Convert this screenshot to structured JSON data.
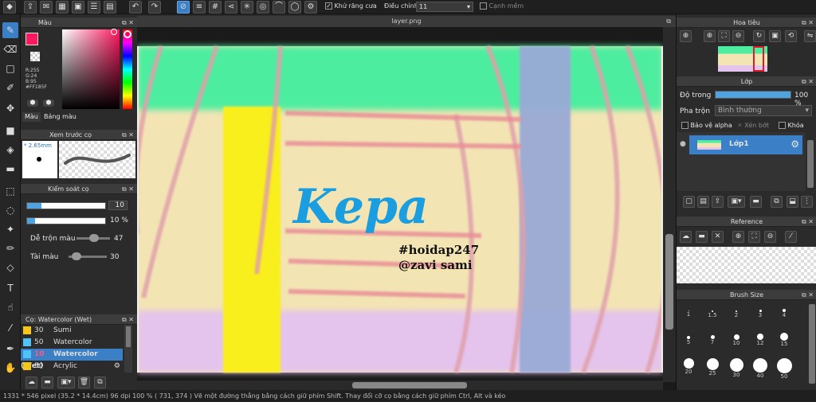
{
  "toolbar": {
    "antialias_label": "Khử răng cưa",
    "correction_label": "Điều chỉnh",
    "correction_value": "11",
    "snap_label": "Cạnh mềm",
    "antialias_checked": true,
    "snap_checked": false
  },
  "document": {
    "tab_title": "layer.png"
  },
  "color_panel": {
    "title": "Màu",
    "r": "R:255",
    "g": "G:24",
    "b": "B:95",
    "hex": "#FF185F",
    "tab_color": "Màu",
    "tab_palette": "Bảng màu",
    "accent": "#FF185F"
  },
  "preview_panel": {
    "title": "Xem trước cọ",
    "size": "2.65mm"
  },
  "brush_control": {
    "title": "Kiểm soát cọ",
    "size_value": "10",
    "opacity_value": "10 %",
    "blend_label": "Dễ trộn màu",
    "blend_value": "47",
    "amount_label": "Tài màu",
    "amount_value": "30"
  },
  "brush_list": {
    "title": "Cọ: Watercolor (Wet)",
    "items": [
      {
        "size": "30",
        "name": "Sumi",
        "color": "#f5c518"
      },
      {
        "size": "50",
        "name": "Watercolor",
        "color": "#4fc3f7"
      },
      {
        "size": "10",
        "name": "Watercolor (Wet)",
        "color": "#4fc3f7"
      },
      {
        "size": "50",
        "name": "Acrylic",
        "color": "#f5c518"
      }
    ]
  },
  "canvas_text": {
    "title": "Kepa",
    "tag1": "#hoidap247",
    "tag2": "@zavi sami"
  },
  "navigator": {
    "title": "Hoa tiêu"
  },
  "layer_panel": {
    "title": "Lớp",
    "opacity_label": "Độ trong",
    "opacity_value": "100 %",
    "blend_label": "Pha trộn",
    "blend_value": "Bình thường",
    "protect_alpha": "Bảo vệ alpha",
    "clipping": "Xén bớt",
    "lock": "Khóa",
    "layer_name": "Lớp1"
  },
  "reference_panel": {
    "title": "Reference"
  },
  "brush_size_panel": {
    "title": "Brush Size",
    "sizes": [
      "1",
      "1.5",
      "2",
      "3",
      "4",
      "5",
      "7",
      "10",
      "12",
      "15",
      "20",
      "25",
      "30",
      "40",
      "50"
    ]
  },
  "status": {
    "text": "1331 * 546 pixel  (35.2 * 14.4cm)  96 dpi  100 %  ( 731, 374 )  Vẽ một đường thẳng bằng cách giữ phím Shift. Thay đổi cỡ cọ bằng cách giữ phím Ctrl, Alt và kéo"
  }
}
